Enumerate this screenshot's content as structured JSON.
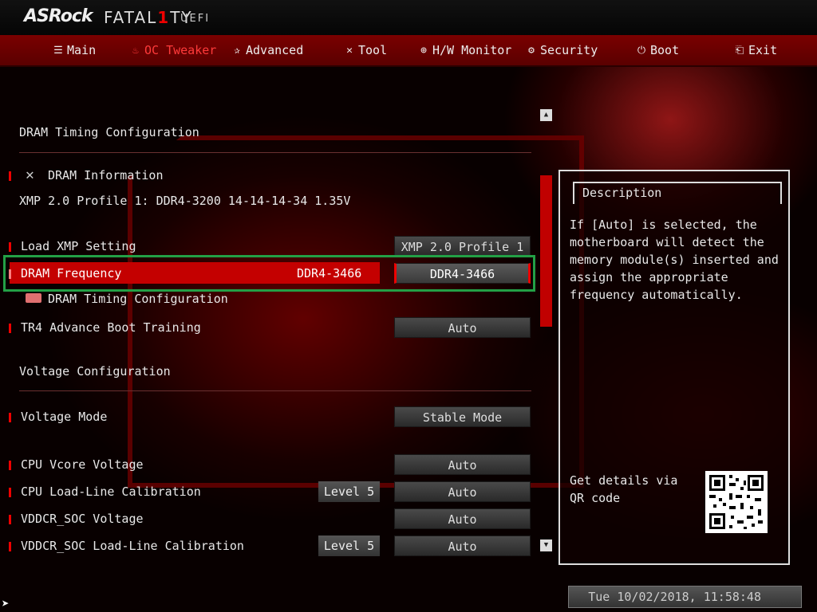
{
  "brand": {
    "logo": "ASRock",
    "product_prefix": "FATAL",
    "product_one": "1",
    "product_suffix": "TY",
    "uefi": "UEFI"
  },
  "nav": {
    "tabs": [
      {
        "label": "Main",
        "icon": "list-icon",
        "active": false
      },
      {
        "label": "OC Tweaker",
        "icon": "flame-icon",
        "active": true
      },
      {
        "label": "Advanced",
        "icon": "star-icon",
        "active": false
      },
      {
        "label": "Tool",
        "icon": "tools-icon",
        "active": false
      },
      {
        "label": "H/W Monitor",
        "icon": "monitor-icon",
        "active": false
      },
      {
        "label": "Security",
        "icon": "shield-icon",
        "active": false
      },
      {
        "label": "Boot",
        "icon": "power-icon",
        "active": false
      },
      {
        "label": "Exit",
        "icon": "exit-door-icon",
        "active": false
      }
    ]
  },
  "main": {
    "section_title": "DRAM Timing Configuration",
    "dram_info_label": "DRAM Information",
    "xmp_info": "XMP 2.0 Profile 1: DDR4-3200 14-14-14-34 1.35V",
    "load_xmp": {
      "label": "Load XMP Setting",
      "value": "XMP 2.0 Profile 1"
    },
    "dram_frequency": {
      "label": "DRAM Frequency",
      "current": "DDR4-3466",
      "value": "DDR4-3466"
    },
    "dram_timing_config": "DRAM Timing Configuration",
    "tr4_training": {
      "label": "TR4 Advance Boot Training",
      "value": "Auto"
    },
    "voltage_section": "Voltage Configuration",
    "voltage_mode": {
      "label": "Voltage Mode",
      "value": "Stable Mode"
    },
    "cpu_vcore": {
      "label": "CPU Vcore Voltage",
      "value": "Auto"
    },
    "cpu_llc": {
      "label": "CPU Load-Line Calibration",
      "current": "Level 5",
      "value": "Auto"
    },
    "vddcr_soc": {
      "label": "VDDCR_SOC Voltage",
      "value": "Auto"
    },
    "vddcr_soc_llc": {
      "label": "VDDCR_SOC Load-Line Calibration",
      "current": "Level 5",
      "value": "Auto"
    }
  },
  "description": {
    "title": "Description",
    "text": "If [Auto] is selected, the motherboard will detect the memory module(s) inserted and assign the appropriate frequency automatically.",
    "qr_text": "Get details via QR code"
  },
  "status": {
    "datetime": "Tue 10/02/2018, 11:58:48"
  },
  "colors": {
    "accent": "#c40000",
    "highlight_border": "#23a046",
    "active_tab": "#ff3a3a"
  }
}
